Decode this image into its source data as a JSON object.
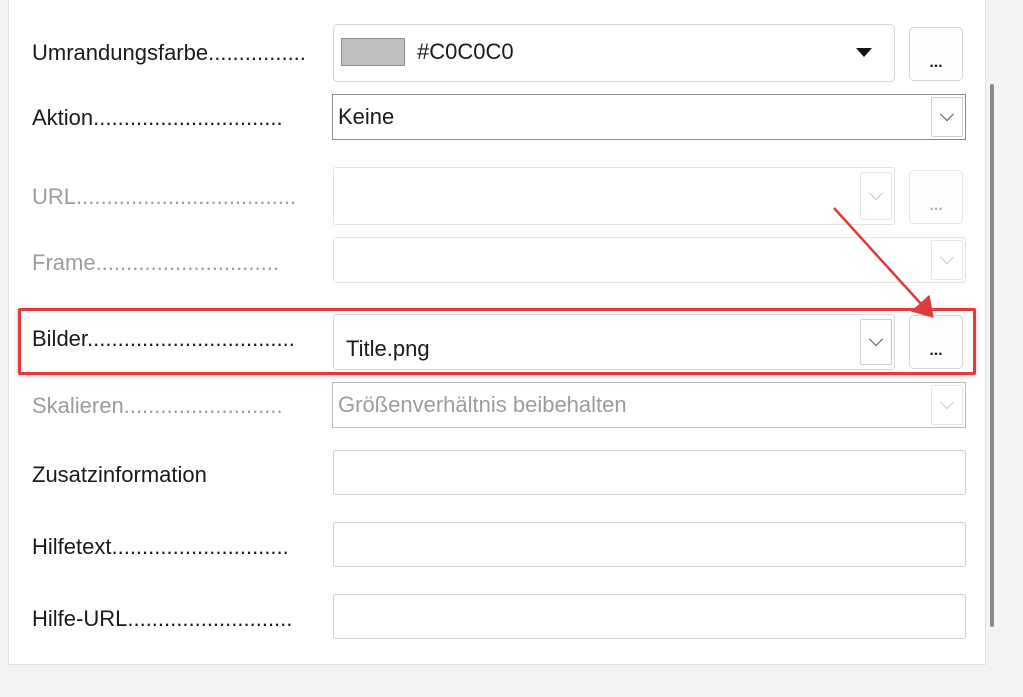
{
  "colors": {
    "accent_red": "#e03a3a",
    "swatch": "#c0c0c0"
  },
  "rows": {
    "border_color": {
      "label": "Umrandungsfarbe",
      "dots": "................",
      "value": "#C0C0C0",
      "button": "..."
    },
    "action": {
      "label": "Aktion",
      "dots": "...............................",
      "value": "Keine"
    },
    "url": {
      "label": "URL",
      "dots": "....................................",
      "value": "",
      "button": "..."
    },
    "frame": {
      "label": "Frame",
      "dots": "..............................",
      "value": ""
    },
    "images": {
      "label": "Bilder",
      "dots": "..................................",
      "value": "Title.png",
      "button": "..."
    },
    "scale": {
      "label": "Skalieren",
      "dots": "..........................",
      "value": "Größenverhältnis beibehalten"
    },
    "additional_info": {
      "label": "Zusatzinformation",
      "value": ""
    },
    "help_text": {
      "label": "Hilfetext",
      "dots": ".............................",
      "value": ""
    },
    "help_url": {
      "label": "Hilfe-URL",
      "dots": "...........................",
      "value": ""
    }
  },
  "icons": {
    "dropdown": "chevron-down-icon",
    "color_dropdown": "triangle-down-icon",
    "annotation": "arrow-annotation"
  }
}
